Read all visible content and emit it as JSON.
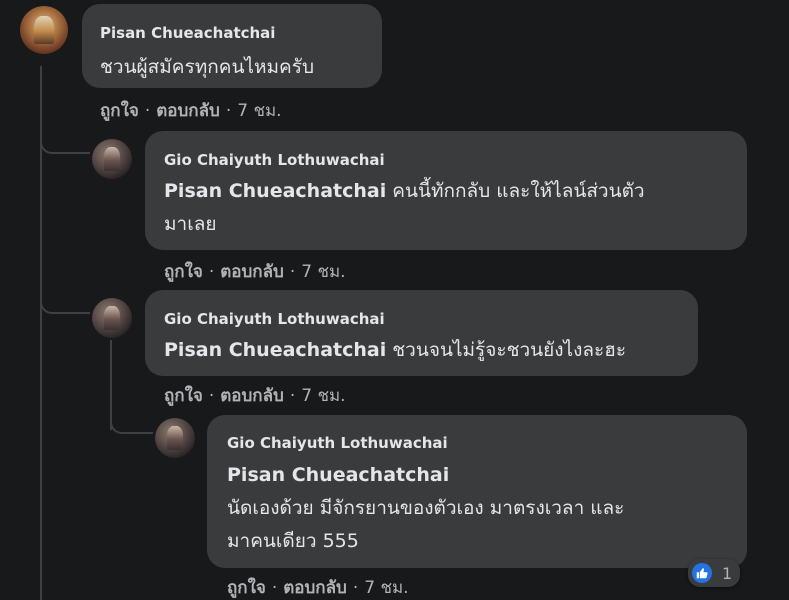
{
  "comments": [
    {
      "author": "Pisan Chueachatchai",
      "text": "ชวนผู้สมัครทุกคนไหมครับ",
      "actions": {
        "like": "ถูกใจ",
        "reply": "ตอบกลับ",
        "time": "7 ชม."
      }
    },
    {
      "author": "Gio Chaiyuth Lothuwachai",
      "mention": "Pisan Chueachatchai",
      "text_line1": "คนนี้ทักกลับ และให้ไลน์ส่วนตัว",
      "text_line2": "มาเลย",
      "actions": {
        "like": "ถูกใจ",
        "reply": "ตอบกลับ",
        "time": "7 ชม."
      }
    },
    {
      "author": "Gio Chaiyuth Lothuwachai",
      "mention": "Pisan Chueachatchai",
      "text": "ชวนจนไม่รู้จะชวนยังไงละฮะ",
      "actions": {
        "like": "ถูกใจ",
        "reply": "ตอบกลับ",
        "time": "7 ชม."
      }
    },
    {
      "author": "Gio Chaiyuth Lothuwachai",
      "mention": "Pisan Chueachatchai",
      "text_line1": "นัดเองด้วย มีจักรยานของตัวเอง มาตรงเวลา และ",
      "text_line2": "มาคนเดียว 555",
      "actions": {
        "like": "ถูกใจ",
        "reply": "ตอบกลับ",
        "time": "7 ชม."
      },
      "reactions": {
        "icon": "like-icon",
        "count": "1"
      }
    }
  ],
  "separator": "·",
  "colors": {
    "background": "#18191a",
    "bubble": "#3a3b3c",
    "like_blue": "#2374e1"
  }
}
